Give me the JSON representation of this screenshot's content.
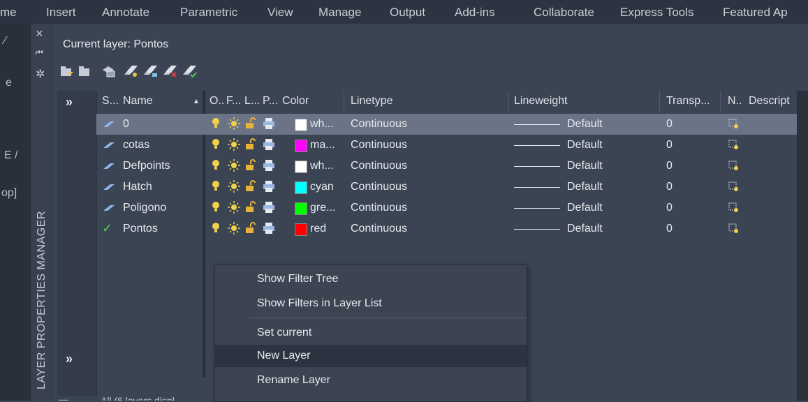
{
  "menubar": {
    "items": [
      "me",
      "Insert",
      "Annotate",
      "Parametric",
      "View",
      "Manage",
      "Output",
      "Add-ins",
      "Collaborate",
      "Express Tools",
      "Featured Ap"
    ]
  },
  "left_fragments": {
    "line1": "e",
    "line2": "E /",
    "line3": "op]"
  },
  "palette": {
    "title": "LAYER PROPERTIES MANAGER",
    "close_glyph": "×",
    "autohide_glyph": "⏮",
    "settings_glyph": "✲"
  },
  "current_layer": "Current layer: Pontos",
  "toolbar": {
    "icons": [
      "new-property-filter-icon",
      "new-group-filter-icon",
      "layer-states-manager-icon",
      "new-layer-icon",
      "new-layer-vp-frozen-icon",
      "delete-layer-icon",
      "set-current-icon"
    ]
  },
  "filter_pane": {
    "expand_top": "»",
    "expand_bottom": "»"
  },
  "columns": {
    "status": "S...",
    "name": "Name",
    "sort_arrow": "▲",
    "on": "O..",
    "freeze": "F...",
    "lock": "L...",
    "plot": "P...",
    "color": "Color",
    "linetype": "Linetype",
    "lineweight": "Lineweight",
    "transparency": "Transp...",
    "newvp": "N..",
    "description": "Descript"
  },
  "layers": [
    {
      "name": "0",
      "color_name": "wh...",
      "color_hex": "#ffffff",
      "linetype": "Continuous",
      "lineweight": "Default",
      "transparency": "0",
      "current": false,
      "selected": true
    },
    {
      "name": "cotas",
      "color_name": "ma...",
      "color_hex": "#ff00ff",
      "linetype": "Continuous",
      "lineweight": "Default",
      "transparency": "0",
      "current": false,
      "selected": false
    },
    {
      "name": "Defpoints",
      "color_name": "wh...",
      "color_hex": "#ffffff",
      "linetype": "Continuous",
      "lineweight": "Default",
      "transparency": "0",
      "current": false,
      "selected": false
    },
    {
      "name": "Hatch",
      "color_name": "cyan",
      "color_hex": "#00ffff",
      "linetype": "Continuous",
      "lineweight": "Default",
      "transparency": "0",
      "current": false,
      "selected": false
    },
    {
      "name": "Poligono",
      "color_name": "gre...",
      "color_hex": "#00ff00",
      "linetype": "Continuous",
      "lineweight": "Default",
      "transparency": "0",
      "current": false,
      "selected": false
    },
    {
      "name": "Pontos",
      "color_name": "red",
      "color_hex": "#ff0000",
      "linetype": "Continuous",
      "lineweight": "Default",
      "transparency": "0",
      "current": true,
      "selected": false
    }
  ],
  "context_menu": {
    "items": [
      {
        "label": "Show Filter Tree",
        "highlighted": false
      },
      {
        "label": "Show Filters in Layer List",
        "highlighted": false
      },
      {
        "label": "Set current",
        "highlighted": false
      },
      {
        "label": "New Layer",
        "highlighted": true
      },
      {
        "label": "Rename Layer",
        "highlighted": false
      }
    ]
  },
  "bottom_fragment": "All (6 layers displ"
}
